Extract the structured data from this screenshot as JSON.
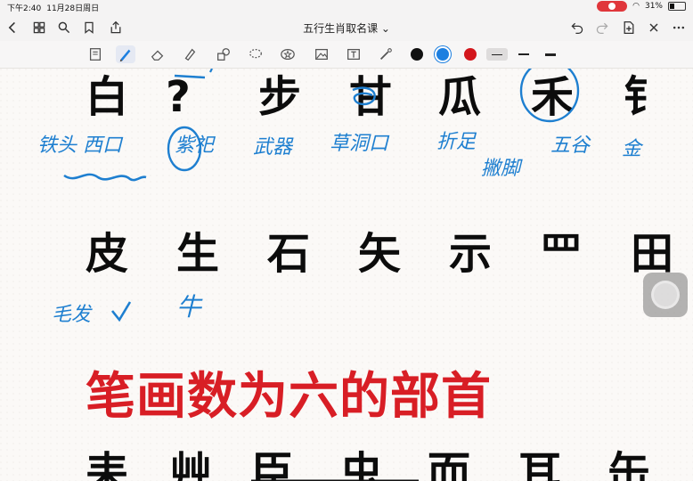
{
  "status": {
    "time": "下午2:40",
    "date": "11月28日周日",
    "battery": "31%",
    "battery_level": 0.31
  },
  "document": {
    "title": "五行生肖取名课 ⌄"
  },
  "toolbar": {
    "tools": [
      "insert-page-icon",
      "pen-icon",
      "eraser-icon",
      "highlighter-icon",
      "shapes-icon",
      "lasso-icon",
      "sticker-icon",
      "image-icon",
      "text-box-icon",
      "laser-pointer-icon"
    ],
    "colors": [
      "#111111",
      "#1c7fe0",
      "#d3161c"
    ]
  },
  "canvas": {
    "row1": [
      "白",
      "?",
      "步",
      "甘",
      "瓜",
      "禾",
      "钅"
    ],
    "row2": [
      "皮",
      "生",
      "石",
      "矢",
      "示",
      "罒",
      "田"
    ],
    "heading": "笔画数为六的部首",
    "row3": [
      "耒",
      "艸",
      "臣",
      "虫",
      "而",
      "耳",
      "缶"
    ],
    "notes": {
      "n1": "铁头 西口",
      "n2": "紫祀",
      "n3": "武器",
      "n4": "草洞口",
      "n5": "折足",
      "n5b": "撇脚",
      "n6": "五谷",
      "n7": "金",
      "n8": "毛发",
      "n9": "牛"
    }
  }
}
